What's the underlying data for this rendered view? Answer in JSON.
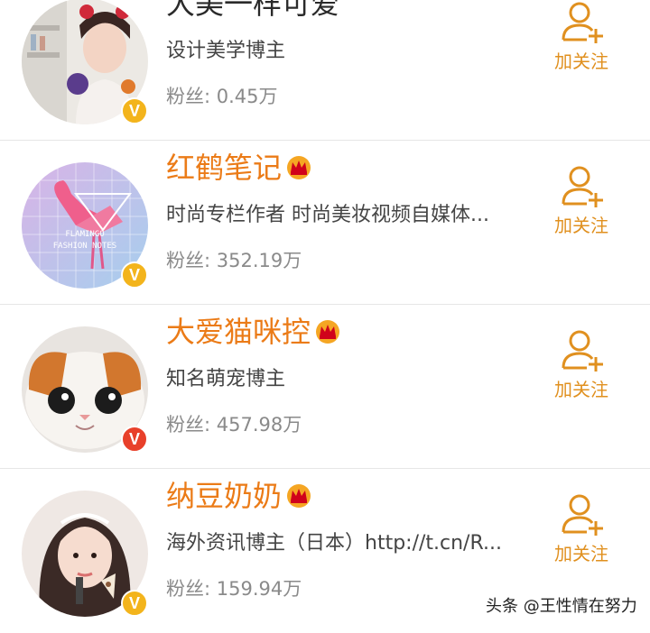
{
  "users": [
    {
      "name": "大美一样可爱",
      "name_style": "dark",
      "has_crown": false,
      "description": "设计美学博主",
      "fans": "粉丝: 0.45万",
      "badge": "V",
      "badge_color": "#f3b41c",
      "follow_label": "加关注"
    },
    {
      "name": "红鹤笔记",
      "name_style": "orange",
      "has_crown": true,
      "description": "时尚专栏作者 时尚美妆视频自媒体...",
      "fans": "粉丝: 352.19万",
      "badge": "V",
      "badge_color": "#f3b41c",
      "avatar_text": "FLAMINGO FASHION NOTES",
      "follow_label": "加关注"
    },
    {
      "name": "大爱猫咪控",
      "name_style": "orange",
      "has_crown": true,
      "description": "知名萌宠博主",
      "fans": "粉丝: 457.98万",
      "badge": "V",
      "badge_color": "#e8402a",
      "follow_label": "加关注"
    },
    {
      "name": "纳豆奶奶",
      "name_style": "orange",
      "has_crown": true,
      "description": "海外资讯博主（日本）http://t.cn/R...",
      "fans": "粉丝: 159.94万",
      "badge": "V",
      "badge_color": "#f3b41c",
      "follow_label": "加关注"
    }
  ],
  "colors": {
    "accent": "#eb7b17",
    "follow": "#e0901f",
    "badge_gold": "#f3b41c",
    "badge_red": "#e8402a"
  },
  "icons": {
    "follow": "add-user-icon",
    "crown": "crown-icon",
    "verified": "verified-badge-icon"
  },
  "watermark": "头条 @王性情在努力"
}
